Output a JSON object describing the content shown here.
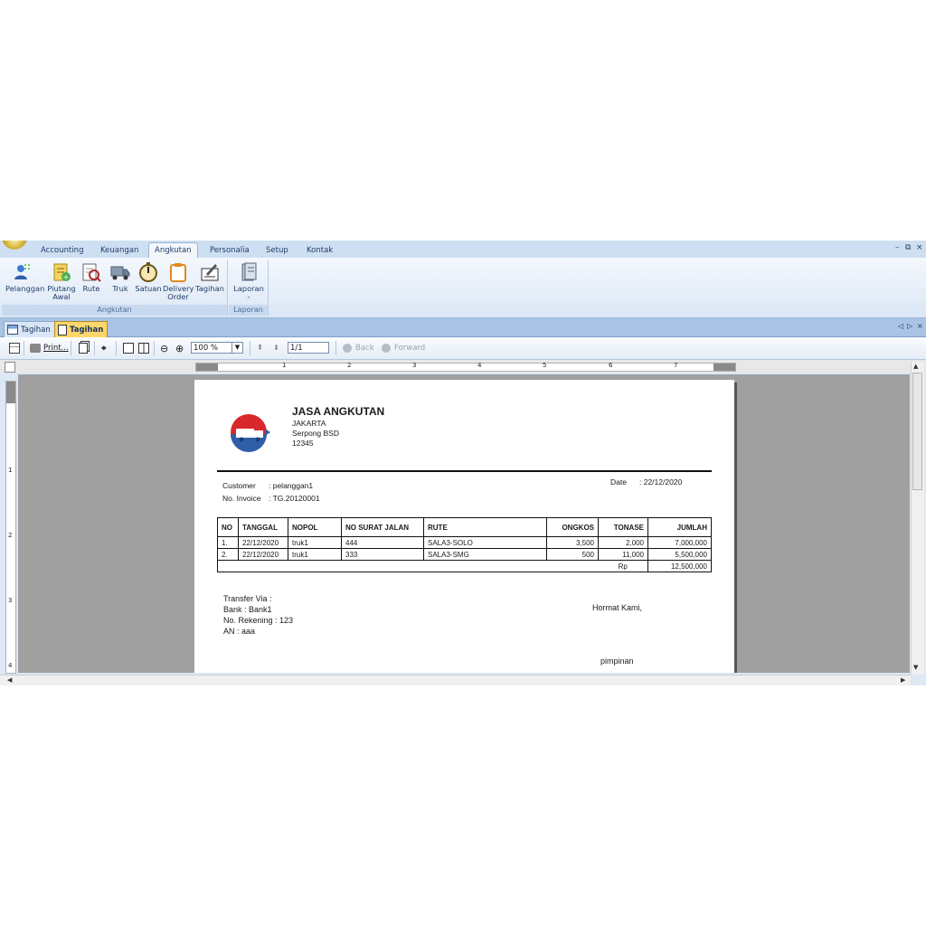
{
  "ribbon_tabs": [
    "Accounting",
    "Keuangan",
    "Angkutan",
    "Personalia",
    "Setup",
    "Kontak"
  ],
  "active_ribbon_tab": "Angkutan",
  "window_controls": {
    "minimize": "–",
    "restore": "⧉",
    "close": "×"
  },
  "ribbon_groups": {
    "angkutan": {
      "label": "Angkutan",
      "buttons": [
        {
          "line1": "Pelanggan",
          "line2": "",
          "icon": "customer-icon"
        },
        {
          "line1": "Piutang",
          "line2": "Awal",
          "icon": "receivable-icon"
        },
        {
          "line1": "Rute",
          "line2": "",
          "icon": "route-icon"
        },
        {
          "line1": "Truk",
          "line2": "",
          "icon": "truck-icon"
        },
        {
          "line1": "Satuan",
          "line2": "",
          "icon": "gauge-icon"
        },
        {
          "line1": "Delivery",
          "line2": "Order",
          "icon": "clipboard-icon"
        },
        {
          "line1": "Tagihan",
          "line2": "",
          "icon": "invoice-sign-icon"
        }
      ]
    },
    "laporan": {
      "label": "Laporan",
      "buttons": [
        {
          "line1": "Laporan",
          "line2": "-",
          "icon": "report-icon"
        }
      ]
    }
  },
  "doc_tabs": [
    {
      "label": "Tagihan",
      "active": false
    },
    {
      "label": "Tagihan",
      "active": true
    }
  ],
  "doc_controls": {
    "left": "◁",
    "right": "▷",
    "close": "×"
  },
  "toolbar": {
    "print_label": "Print...",
    "zoom": "100 %",
    "page": "1/1",
    "back_label": "Back",
    "forward_label": "Forward"
  },
  "ruler": {
    "h_numbers": [
      "1",
      "2",
      "3",
      "4",
      "5",
      "6",
      "7"
    ],
    "v_numbers": [
      "1",
      "2",
      "3",
      "4"
    ]
  },
  "invoice": {
    "company_name": "JASA ANGKUTAN",
    "company_city": "JAKARTA",
    "company_address": "Serpong BSD",
    "company_postcode": "12345",
    "customer_label": "Customer",
    "customer_value": ": pelanggan1",
    "invoice_label": "No. Invoice",
    "invoice_value": ": TG.20120001",
    "date_label": "Date",
    "date_value": ": 22/12/2020",
    "columns": [
      "NO",
      "TANGGAL",
      "NOPOL",
      "NO SURAT JALAN",
      "RUTE",
      "ONGKOS",
      "TONASE",
      "JUMLAH"
    ],
    "rows": [
      [
        "1.",
        "22/12/2020",
        "truk1",
        "444",
        "SALA3-SOLO",
        "3,500",
        "2,000",
        "7,000,000"
      ],
      [
        "2.",
        "22/12/2020",
        "truk1",
        "333",
        "SALA3-SMG",
        "500",
        "11,000",
        "5,500,000"
      ]
    ],
    "total_currency": "Rp",
    "total_value": "12,500,000",
    "transfer_title": "Transfer Via :",
    "bank_line": "Bank : Bank1",
    "account_line": "No. Rekening : 123",
    "an_line": "AN : aaa",
    "closing": "Hormat Kami,",
    "signer_title": "pimpinan"
  },
  "colors": {
    "ribbon": "#dbe7f5",
    "active_doc_tab": "#ffd66b",
    "preview_bg": "#a0a0a0"
  }
}
